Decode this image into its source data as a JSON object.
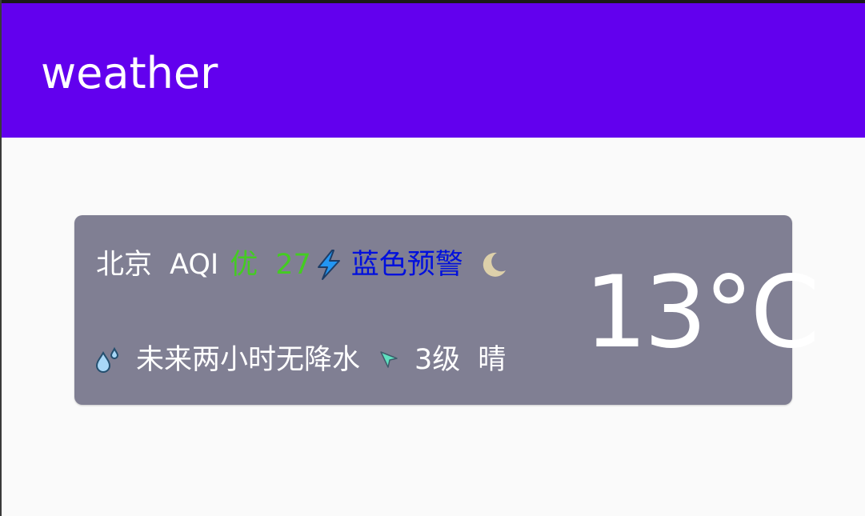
{
  "app_bar": {
    "title": "weather",
    "color": "#6200ee"
  },
  "card": {
    "background": "#807f93",
    "city": "北京",
    "aqi_label": "AQI",
    "aqi_level": "优",
    "aqi_value": "27",
    "aqi_color": "#44cc22",
    "alert_icon": "lightning-icon",
    "alert_text": "蓝色预警",
    "alert_color": "#0010dd",
    "sky_icon": "moon-icon",
    "rain_icon": "raindrops-icon",
    "rain_forecast": "未来两小时无降水",
    "wind_icon": "wind-direction-icon",
    "wind_level": "3级",
    "condition": "晴",
    "temperature": "13°C"
  }
}
